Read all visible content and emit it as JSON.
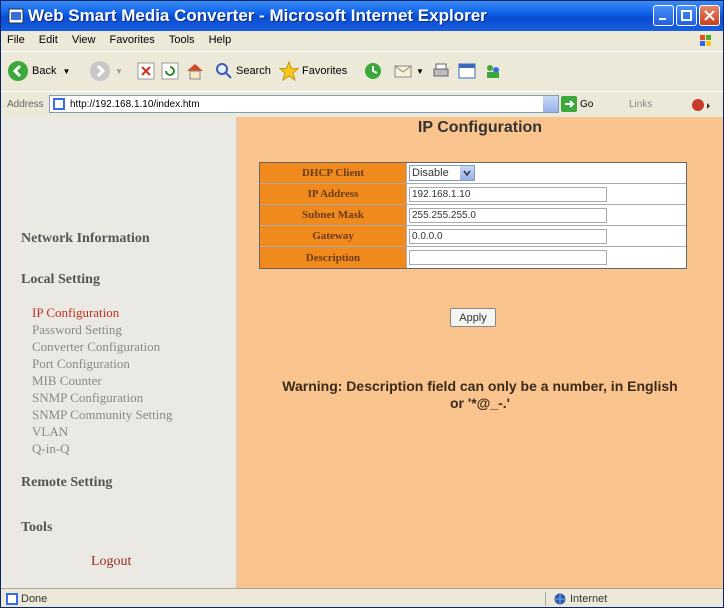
{
  "window": {
    "title": "Web Smart Media Converter - Microsoft Internet Explorer"
  },
  "menu": [
    "File",
    "Edit",
    "View",
    "Favorites",
    "Tools",
    "Help"
  ],
  "toolbar": {
    "back": "Back",
    "search": "Search",
    "favorites": "Favorites"
  },
  "address": {
    "label": "Address",
    "url": "http://192.168.1.10/index.htm",
    "go": "Go",
    "links": "Links"
  },
  "nav": {
    "network_info": "Network Information",
    "local_setting": "Local Setting",
    "items": [
      "IP Configuration",
      "Password Setting",
      "Converter Configuration",
      "Port Configuration",
      "MIB Counter",
      "SNMP Configuration",
      "SNMP Community Setting",
      "VLAN",
      "Q-in-Q"
    ],
    "remote_setting": "Remote Setting",
    "tools": "Tools",
    "logout": "Logout"
  },
  "page": {
    "title": "IP Configuration",
    "dhcp_label": "DHCP Client",
    "dhcp_value": "Disable",
    "ip_label": "IP Address",
    "ip_value": "192.168.1.10",
    "mask_label": "Subnet Mask",
    "mask_value": "255.255.255.0",
    "gateway_label": "Gateway",
    "gateway_value": "0.0.0.0",
    "desc_label": "Description",
    "desc_value": "",
    "apply": "Apply",
    "warning_line1": "Warning: Description field can only be a number, in English",
    "warning_line2": "or '*@_-.'"
  },
  "status": {
    "text": "Done",
    "zone": "Internet"
  },
  "colors": {
    "accent": "#f08a1c",
    "panel": "#f9c48e",
    "active_link": "#c03020"
  }
}
